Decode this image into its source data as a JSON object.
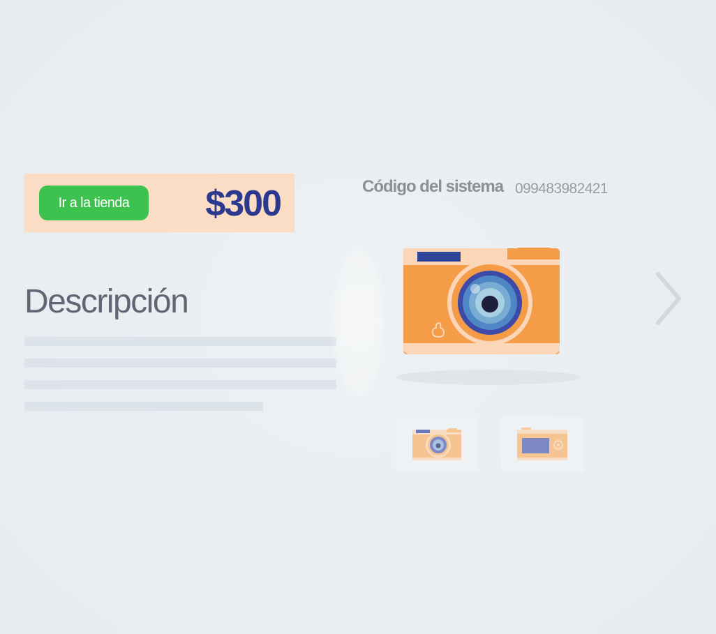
{
  "product": {
    "store_button_label": "Ir a la tienda",
    "price": "$300"
  },
  "system_code": {
    "label": "Código del sistema",
    "value": "099483982421"
  },
  "description": {
    "title": "Descripción"
  },
  "gallery": {
    "main_image_icon": "camera-front-icon",
    "thumbnails": [
      "camera-front-icon",
      "camera-back-icon"
    ],
    "next_icon": "chevron-right-icon"
  },
  "colors": {
    "price_panel": "#fbddc6",
    "store_button": "#3ec24f",
    "price_text": "#2b3a8f",
    "camera_body": "#f49c48",
    "description_title": "#636576"
  }
}
